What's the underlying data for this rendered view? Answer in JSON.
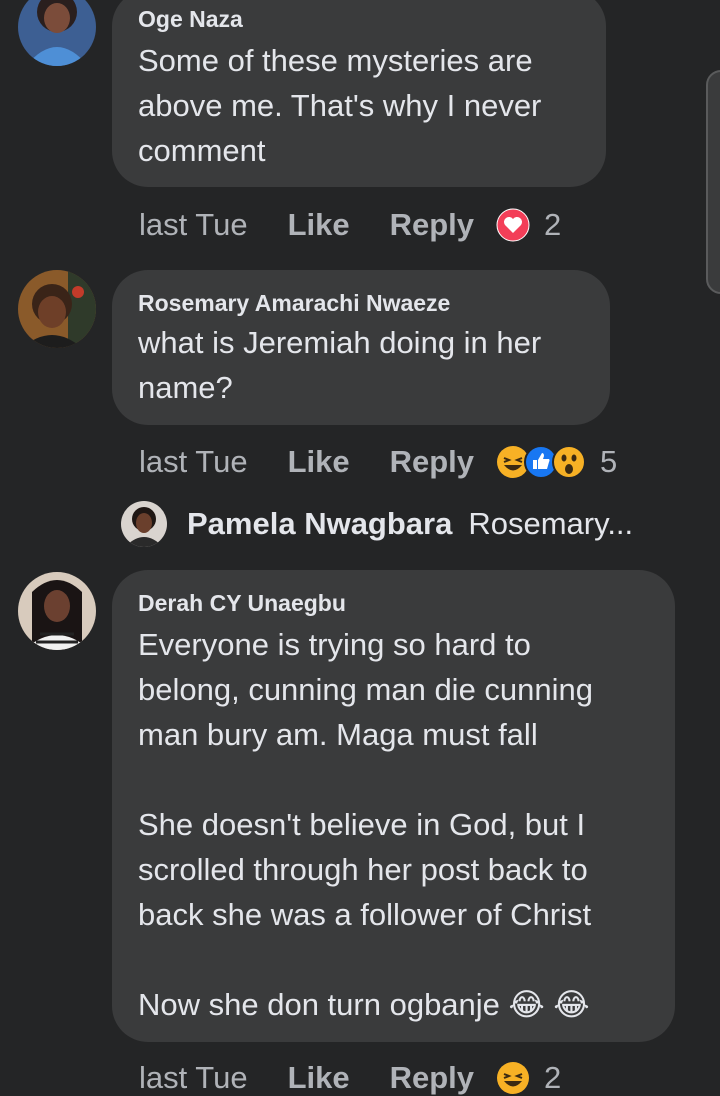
{
  "comments": [
    {
      "author": "Oge Naza",
      "text": "Some of these mysteries are\nabove me. That's why I never\ncomment",
      "time": "last Tue",
      "like": "Like",
      "reply": "Reply",
      "reaction_icons": [
        "love-icon"
      ],
      "reaction_count": "2"
    },
    {
      "author": "Rosemary Amarachi Nwaeze",
      "text": "what is Jeremiah doing in her\nname?",
      "time": "last Tue",
      "like": "Like",
      "reply": "Reply",
      "reaction_icons": [
        "haha-icon",
        "like-icon",
        "wow-icon"
      ],
      "reaction_count": "5",
      "reply_preview": {
        "name": "Pamela Nwagbara",
        "snippet": "Rosemary..."
      }
    },
    {
      "author": "Derah CY Unaegbu",
      "text": "Everyone is trying so hard to\nbelong, cunning man die cunning\nman bury am. Maga must fall\n\nShe doesn't believe in God, but I\nscrolled through her post back to\nback she was a follower of Christ\n\nNow she don turn ogbanje 😂 😂",
      "time": "last Tue",
      "like": "Like",
      "reply": "Reply",
      "reaction_icons": [
        "haha-icon"
      ],
      "reaction_count": "2"
    }
  ],
  "colors": {
    "background": "#242526",
    "bubble": "#3a3b3c",
    "text": "#e4e6eb",
    "secondary": "#b0b3b8",
    "love": "#f33e58",
    "like": "#1877f2",
    "haha": "#f7b125"
  }
}
